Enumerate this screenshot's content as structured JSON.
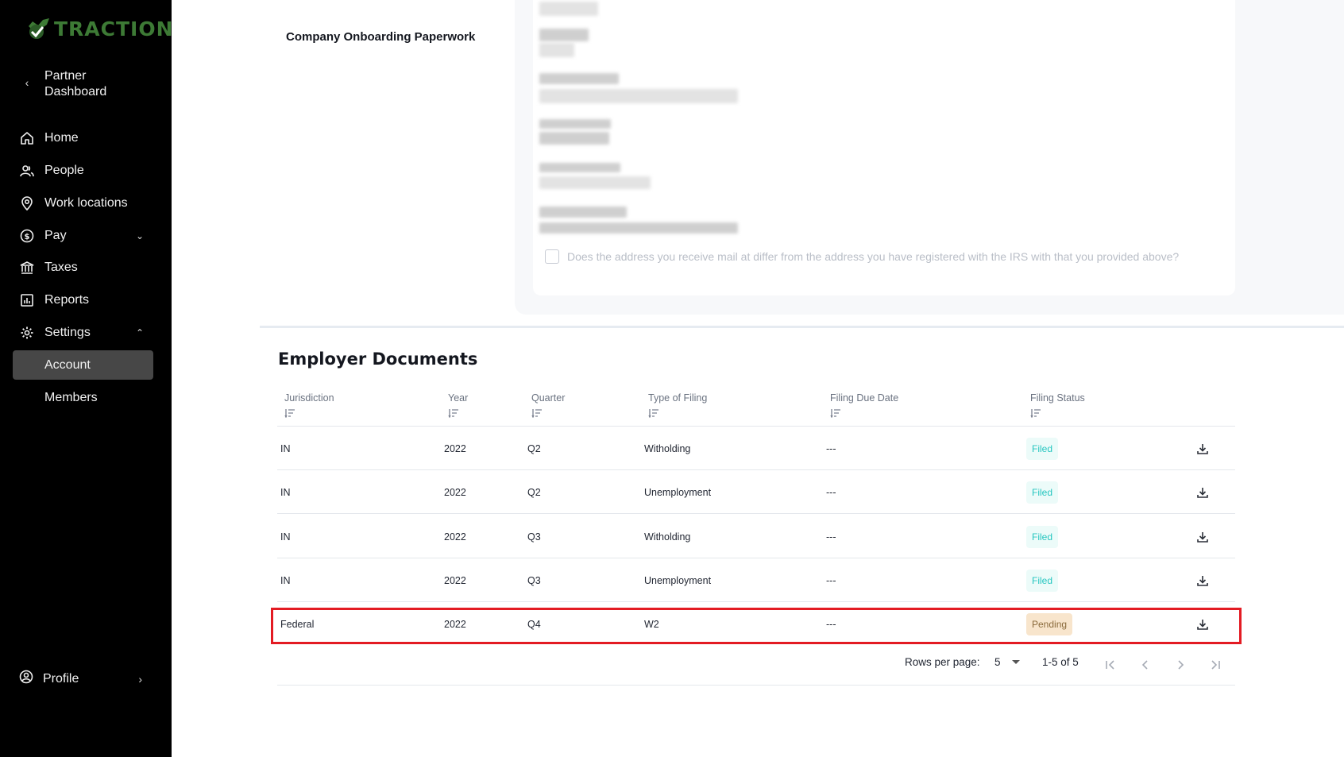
{
  "sidebar": {
    "logo_text": "TRACTION",
    "back_label": "Partner Dashboard",
    "items": [
      {
        "label": "Home"
      },
      {
        "label": "People"
      },
      {
        "label": "Work locations"
      },
      {
        "label": "Pay"
      },
      {
        "label": "Taxes"
      },
      {
        "label": "Reports"
      },
      {
        "label": "Settings"
      },
      {
        "label": "Account"
      },
      {
        "label": "Members"
      }
    ],
    "profile_label": "Profile"
  },
  "form": {
    "section_label": "Company Onboarding Paperwork",
    "mail_question": "Does the address you receive mail at differ from the address you have registered with the IRS with that you provided above?"
  },
  "documents": {
    "title": "Employer Documents",
    "columns": [
      "Jurisdiction",
      "Year",
      "Quarter",
      "Type of Filing",
      "Filing Due Date",
      "Filing Status"
    ],
    "rows": [
      {
        "jurisdiction": "IN",
        "year": "2022",
        "quarter": "Q2",
        "type": "Witholding",
        "due": "---",
        "status": "Filed"
      },
      {
        "jurisdiction": "IN",
        "year": "2022",
        "quarter": "Q2",
        "type": "Unemployment",
        "due": "---",
        "status": "Filed"
      },
      {
        "jurisdiction": "IN",
        "year": "2022",
        "quarter": "Q3",
        "type": "Witholding",
        "due": "---",
        "status": "Filed"
      },
      {
        "jurisdiction": "IN",
        "year": "2022",
        "quarter": "Q3",
        "type": "Unemployment",
        "due": "---",
        "status": "Filed"
      },
      {
        "jurisdiction": "Federal",
        "year": "2022",
        "quarter": "Q4",
        "type": "W2",
        "due": "---",
        "status": "Pending"
      }
    ],
    "pagination": {
      "rows_per_page_label": "Rows per page:",
      "rows_per_page_value": "5",
      "range": "1-5 of 5"
    }
  }
}
